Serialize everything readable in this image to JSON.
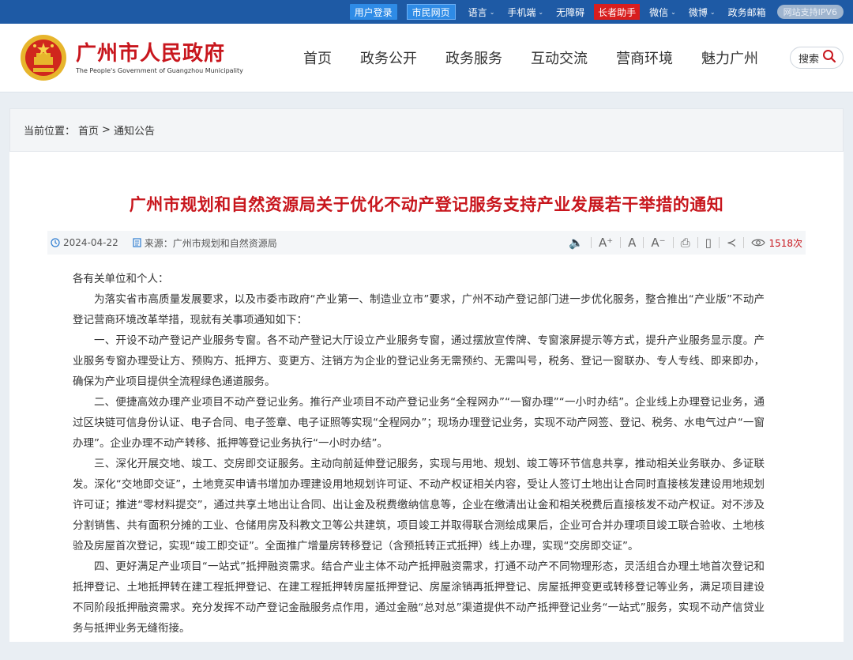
{
  "topbar": {
    "login": "用户登录",
    "citizen": "市民网页",
    "language": "语言",
    "mobile": "手机端",
    "accessible": "无障碍",
    "elder": "长者助手",
    "wechat": "微信",
    "weibo": "微博",
    "mail": "政务邮箱",
    "ipv6": "网站支持IPV6"
  },
  "header": {
    "site_name": "广州市人民政府",
    "site_name_en": "The People's Government of Guangzhou Municipality",
    "nav": [
      "首页",
      "政务公开",
      "政务服务",
      "互动交流",
      "营商环境",
      "魅力广州"
    ],
    "search_label": "搜索"
  },
  "breadcrumb": {
    "prefix": "当前位置：",
    "items": [
      "首页",
      ">",
      "通知公告"
    ]
  },
  "article": {
    "title": "广州市规划和自然资源局关于优化不动产登记服务支持产业发展若干举措的通知",
    "date": "2024-04-22",
    "source": "来源：广州市规划和自然资源局",
    "views": "1518次",
    "salutation": "各有关单位和个人：",
    "paragraphs": [
      "为落实省市高质量发展要求，以及市委市政府“产业第一、制造业立市”要求，广州不动产登记部门进一步优化服务，整合推出“产业版”不动产登记营商环境改革举措，现就有关事项通知如下：",
      "一、开设不动产登记产业服务专窗。各不动产登记大厅设立产业服务专窗，通过摆放宣传牌、专窗滚屏提示等方式，提升产业服务显示度。产业服务专窗办理受让方、预购方、抵押方、变更方、注销方为企业的登记业务无需预约、无需叫号，税务、登记一窗联办、专人专线、即来即办，确保为产业项目提供全流程绿色通道服务。",
      "二、便捷高效办理产业项目不动产登记业务。推行产业项目不动产登记业务“全程网办”“一窗办理”“一小时办结”。企业线上办理登记业务，通过区块链可信身份认证、电子合同、电子签章、电子证照等实现“全程网办”；现场办理登记业务，实现不动产网签、登记、税务、水电气过户“一窗办理”。企业办理不动产转移、抵押等登记业务执行“一小时办结”。",
      "三、深化开展交地、竣工、交房即交证服务。主动向前延伸登记服务，实现与用地、规划、竣工等环节信息共享，推动相关业务联办、多证联发。深化“交地即交证”，土地竞买申请书增加办理建设用地规划许可证、不动产权证相关内容，受让人签订土地出让合同时直接核发建设用地规划许可证；推进“零材料提交”，通过共享土地出让合同、出让金及税费缴纳信息等，企业在缴清出让金和相关税费后直接核发不动产权证。对不涉及分割销售、共有面积分摊的工业、仓储用房及科教文卫等公共建筑，项目竣工并取得联合测绘成果后，企业可合并办理项目竣工联合验收、土地核验及房屋首次登记，实现“竣工即交证”。全面推广增量房转移登记（含预抵转正式抵押）线上办理，实现“交房即交证”。",
      "四、更好满足产业项目“一站式”抵押融资需求。结合产业主体不动产抵押融资需求，打通不动产不同物理形态，灵活组合办理土地首次登记和抵押登记、土地抵押转在建工程抵押登记、在建工程抵押转房屋抵押登记、房屋涂销再抵押登记、房屋抵押变更或转移登记等业务，满足项目建设不同阶段抵押融资需求。充分发挥不动产登记金融服务点作用，通过金融“总对总”渠道提供不动产抵押登记业务“一站式”服务，实现不动产信贷业务与抵押业务无缝衔接。"
    ]
  },
  "colors": {
    "topbar_bg": "#1e5aa5",
    "brand_red": "#c8161d",
    "page_bg": "#e9eef3"
  }
}
